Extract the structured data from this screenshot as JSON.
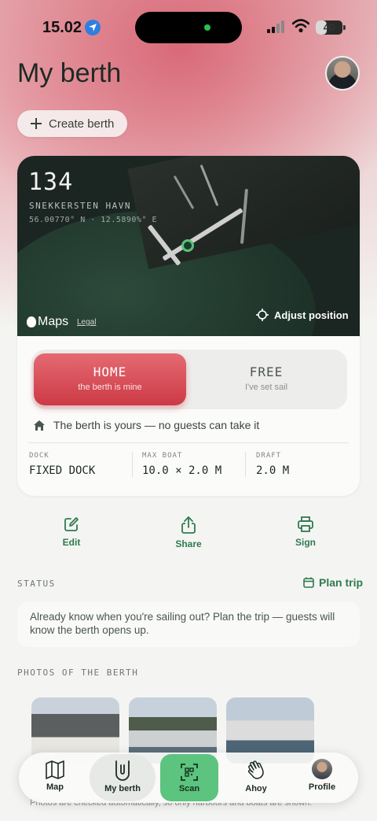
{
  "status_bar": {
    "time": "15.02",
    "battery": "40",
    "battery_level": 0.4
  },
  "header": {
    "title": "My berth",
    "create_button": "Create berth"
  },
  "berth": {
    "number": "134",
    "harbour": "SNEKKERSTEN HAVN",
    "coordinates": "56.00770° N · 12.5890%° E",
    "maps_label": "Maps",
    "legal_label": "Legal",
    "adjust_label": "Adjust position",
    "mode": {
      "home_title": "HOME",
      "home_sub": "the berth is mine",
      "free_title": "FREE",
      "free_sub": "I've set sail"
    },
    "status_line": "The berth is yours — no guests can take it",
    "specs": [
      {
        "key": "DOCK",
        "value": "FIXED DOCK"
      },
      {
        "key": "MAX BOAT",
        "value": "10.0 × 2.0 M"
      },
      {
        "key": "DRAFT",
        "value": "2.0 M"
      }
    ]
  },
  "actions": {
    "edit": "Edit",
    "share": "Share",
    "sign": "Sign"
  },
  "status_section": {
    "label": "STATUS",
    "plan_trip": "Plan trip",
    "text": "Already know when you're sailing out? Plan the trip — guests will know the berth opens up."
  },
  "photos_section": {
    "label": "PHOTOS OF THE BERTH",
    "note": "Photos are checked automatically, so only harbours and boats are shown."
  },
  "tabbar": {
    "map": "Map",
    "my_berth": "My berth",
    "scan": "Scan",
    "ahoy": "Ahoy",
    "profile": "Profile"
  },
  "colors": {
    "accent_green": "#2f7a4f",
    "home_red": "#cc3a45",
    "scan_green": "#5cc47e"
  }
}
